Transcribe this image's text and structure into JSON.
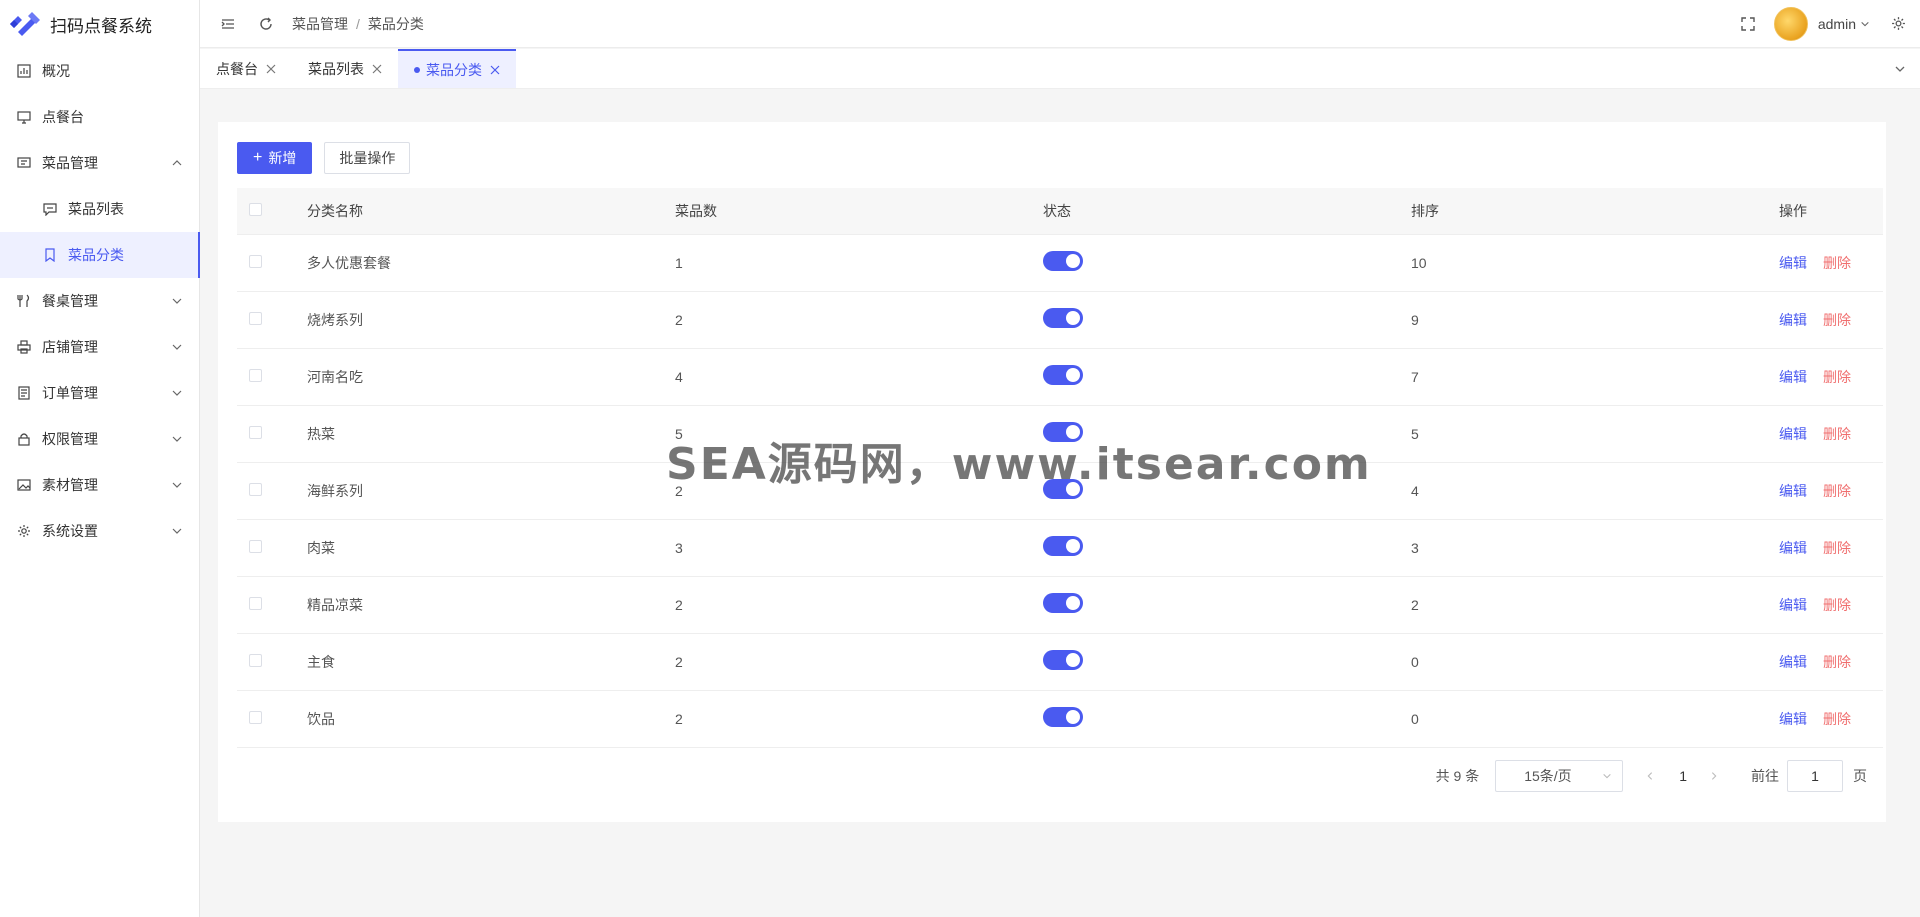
{
  "app": {
    "title": "扫码点餐系统",
    "brand_color": "#4a5af0"
  },
  "header": {
    "breadcrumb": [
      "菜品管理",
      "菜品分类"
    ],
    "user": "admin"
  },
  "sidebar": {
    "items": [
      {
        "label": "概况",
        "icon": "dashboard-icon"
      },
      {
        "label": "点餐台",
        "icon": "monitor-icon"
      },
      {
        "label": "菜品管理",
        "icon": "message-icon",
        "expanded": true
      },
      {
        "label": "菜品列表",
        "icon": "chat-icon",
        "sub": true
      },
      {
        "label": "菜品分类",
        "icon": "bookmark-icon",
        "sub": true,
        "active": true
      },
      {
        "label": "餐桌管理",
        "icon": "fork-knife-icon"
      },
      {
        "label": "店铺管理",
        "icon": "printer-icon"
      },
      {
        "label": "订单管理",
        "icon": "document-icon"
      },
      {
        "label": "权限管理",
        "icon": "lock-icon"
      },
      {
        "label": "素材管理",
        "icon": "image-icon"
      },
      {
        "label": "系统设置",
        "icon": "gear-icon"
      }
    ]
  },
  "tabs": [
    {
      "label": "点餐台"
    },
    {
      "label": "菜品列表"
    },
    {
      "label": "菜品分类",
      "active": true
    }
  ],
  "toolbar": {
    "add_label": "新增",
    "batch_label": "批量操作"
  },
  "table": {
    "columns": [
      "分类名称",
      "菜品数",
      "状态",
      "排序",
      "操作"
    ],
    "edit_label": "编辑",
    "delete_label": "删除",
    "rows": [
      {
        "name": "多人优惠套餐",
        "count": "1",
        "enabled": true,
        "sort": "10"
      },
      {
        "name": "烧烤系列",
        "count": "2",
        "enabled": true,
        "sort": "9"
      },
      {
        "name": "河南名吃",
        "count": "4",
        "enabled": true,
        "sort": "7"
      },
      {
        "name": "热菜",
        "count": "5",
        "enabled": true,
        "sort": "5"
      },
      {
        "name": "海鲜系列",
        "count": "2",
        "enabled": true,
        "sort": "4"
      },
      {
        "name": "肉菜",
        "count": "3",
        "enabled": true,
        "sort": "3"
      },
      {
        "name": "精品凉菜",
        "count": "2",
        "enabled": true,
        "sort": "2"
      },
      {
        "name": "主食",
        "count": "2",
        "enabled": true,
        "sort": "0"
      },
      {
        "name": "饮品",
        "count": "2",
        "enabled": true,
        "sort": "0"
      }
    ]
  },
  "pagination": {
    "total": "共 9 条",
    "page_size": "15条/页",
    "current": "1",
    "goto_label": "前往",
    "goto_value": "1",
    "page_suffix": "页"
  },
  "watermark": "SEA源码网，www.itsear.com"
}
